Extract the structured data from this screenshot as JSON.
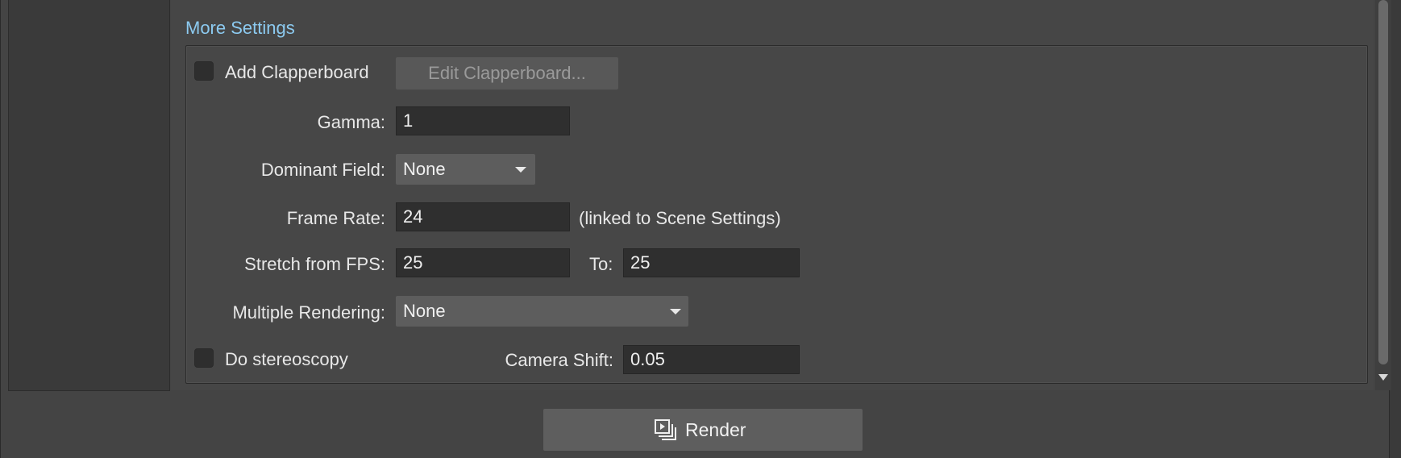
{
  "section": {
    "title": "More Settings"
  },
  "clapperboard": {
    "label": "Add Clapperboard",
    "checked": false,
    "edit_button": "Edit Clapperboard..."
  },
  "gamma": {
    "label": "Gamma:",
    "value": "1"
  },
  "dominant_field": {
    "label": "Dominant Field:",
    "value": "None"
  },
  "frame_rate": {
    "label": "Frame Rate:",
    "value": "24",
    "note": "(linked to Scene Settings)"
  },
  "stretch": {
    "label": "Stretch from FPS:",
    "from_value": "25",
    "to_label": "To:",
    "to_value": "25"
  },
  "multiple_rendering": {
    "label": "Multiple Rendering:",
    "value": "None"
  },
  "stereoscopy": {
    "label": "Do stereoscopy",
    "checked": false,
    "camera_shift_label": "Camera Shift:",
    "camera_shift_value": "0.05"
  },
  "render_button": {
    "label": "Render",
    "icon": "render-icon"
  }
}
